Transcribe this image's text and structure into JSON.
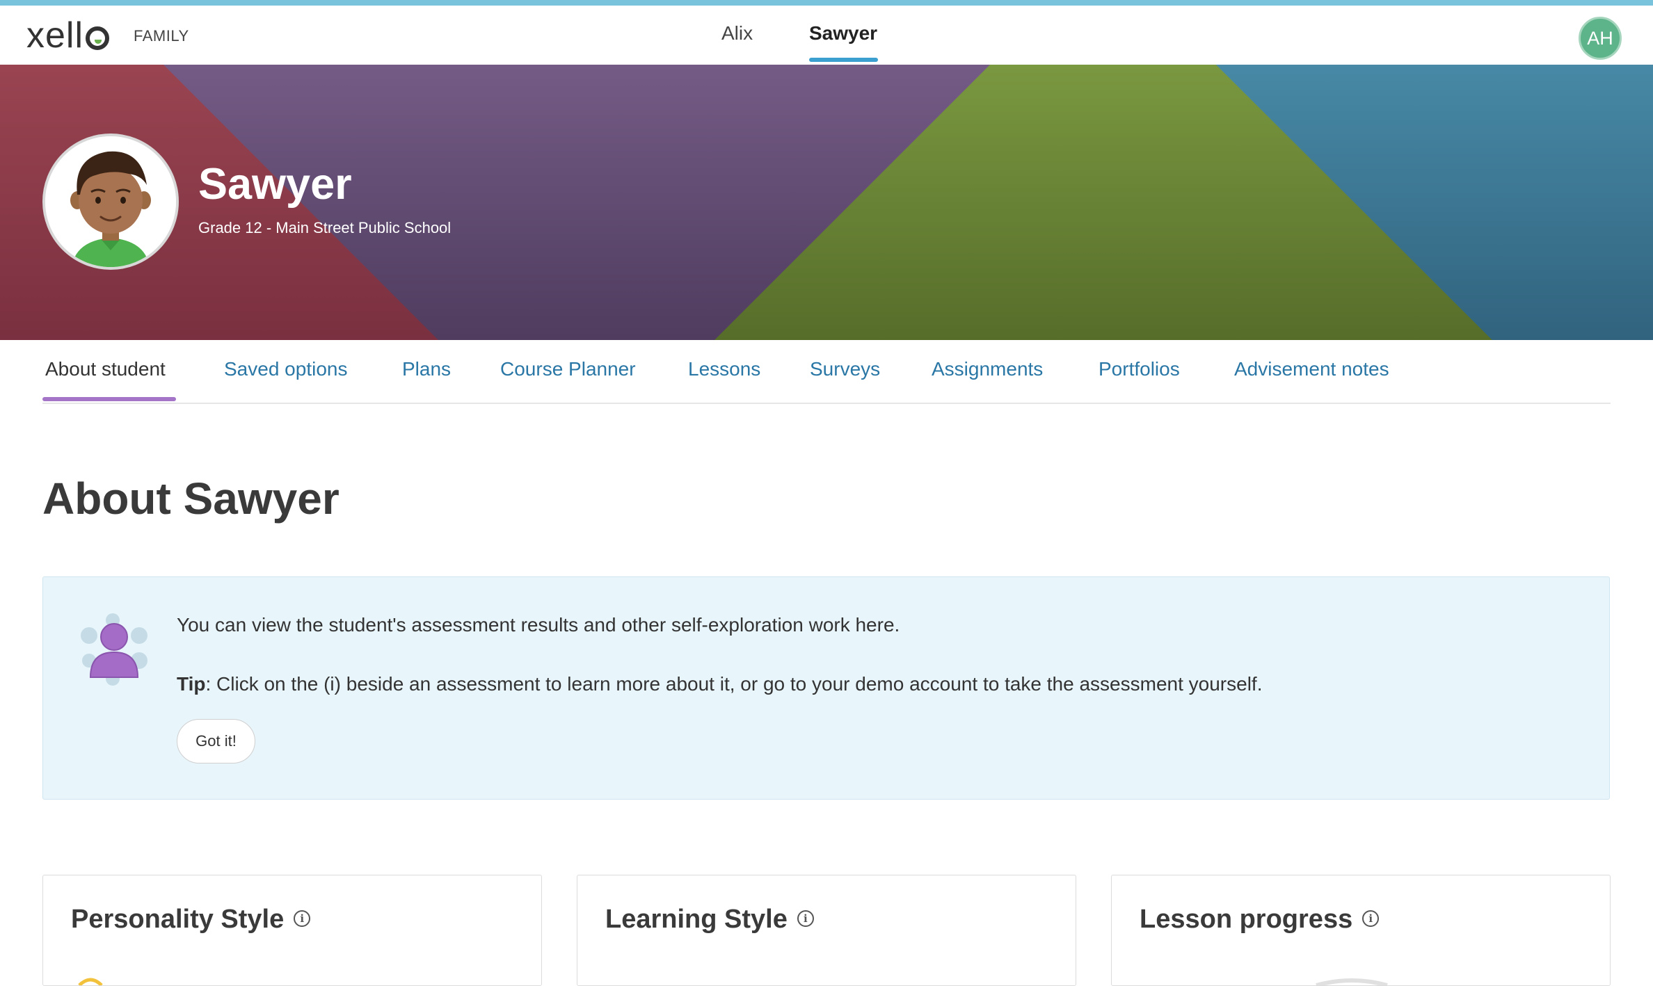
{
  "header": {
    "logo_text": "xell",
    "logo_suffix": "FAMILY",
    "students": [
      "Alix",
      "Sawyer"
    ],
    "active_student": "Sawyer",
    "user_initials": "AH"
  },
  "banner": {
    "name": "Sawyer",
    "subtitle": "Grade 12 - Main Street Public School",
    "colors": [
      "#963f4c",
      "#6d5482",
      "#718d36",
      "#42829e"
    ]
  },
  "tabs": [
    {
      "label": "About student",
      "active": true
    },
    {
      "label": "Saved options"
    },
    {
      "label": "Plans"
    },
    {
      "label": "Course Planner"
    },
    {
      "label": "Lessons"
    },
    {
      "label": "Surveys"
    },
    {
      "label": "Assignments"
    },
    {
      "label": "Portfolios"
    },
    {
      "label": "Advisement notes"
    }
  ],
  "main": {
    "title": "About Sawyer",
    "tip": {
      "line1": "You can view the student's assessment results and other self-exploration work here.",
      "tip_label": "Tip",
      "line2": ": Click on the (i) beside an assessment to learn more about it, or go to your demo account to take the assessment yourself.",
      "button": "Got it!"
    },
    "cards": [
      {
        "title": "Personality Style",
        "info": "i"
      },
      {
        "title": "Learning Style",
        "info": "i"
      },
      {
        "title": "Lesson progress",
        "info": "i"
      }
    ]
  },
  "colors": {
    "accent_blue": "#3ba0d0",
    "tab_link": "#2a77a6",
    "tab_active_underline": "#a374c8",
    "tip_background": "#e8f5fb",
    "avatar_badge": "#5db38a"
  }
}
